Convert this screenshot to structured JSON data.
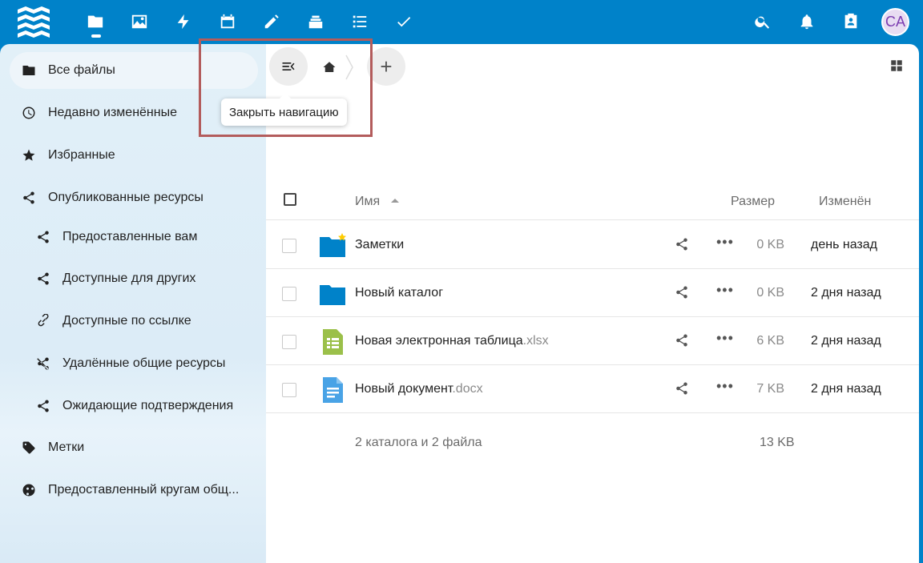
{
  "header": {
    "apps": [
      {
        "name": "files-icon"
      },
      {
        "name": "photos-icon"
      },
      {
        "name": "activity-icon"
      },
      {
        "name": "calendar-icon"
      },
      {
        "name": "notes-icon"
      },
      {
        "name": "deck-icon"
      },
      {
        "name": "tasks-icon"
      },
      {
        "name": "checkmark-icon"
      }
    ],
    "avatar_initials": "CA"
  },
  "sidebar": {
    "items": [
      {
        "label": "Все файлы",
        "icon": "folder-icon",
        "active": true
      },
      {
        "label": "Недавно изменённые",
        "icon": "clock-icon"
      },
      {
        "label": "Избранные",
        "icon": "star-icon"
      },
      {
        "label": "Опубликованные ресурсы",
        "icon": "share-icon"
      },
      {
        "label": "Предоставленные вам",
        "icon": "share-icon",
        "sub": true
      },
      {
        "label": "Доступные для других",
        "icon": "share-icon",
        "sub": true
      },
      {
        "label": "Доступные по ссылке",
        "icon": "link-icon",
        "sub": true
      },
      {
        "label": "Удалённые общие ресурсы",
        "icon": "share-deleted-icon",
        "sub": true
      },
      {
        "label": "Ожидающие подтверждения",
        "icon": "share-icon",
        "sub": true
      },
      {
        "label": "Метки",
        "icon": "tag-icon"
      },
      {
        "label": "Предоставленный кругам общ...",
        "icon": "circles-icon"
      }
    ]
  },
  "toolbar": {
    "tooltip": "Закрыть навигацию",
    "add_label": "+"
  },
  "table": {
    "headers": {
      "name": "Имя",
      "size": "Размер",
      "modified": "Изменён"
    },
    "rows": [
      {
        "name": "Заметки",
        "ext": "",
        "type": "folder",
        "favorite": true,
        "size": "0 KB",
        "modified": "день назад"
      },
      {
        "name": "Новый каталог",
        "ext": "",
        "type": "folder",
        "favorite": false,
        "size": "0 KB",
        "modified": "2 дня назад"
      },
      {
        "name": "Новая электронная таблица",
        "ext": ".xlsx",
        "type": "spreadsheet",
        "favorite": false,
        "size": "6 KB",
        "modified": "2 дня назад"
      },
      {
        "name": "Новый документ",
        "ext": ".docx",
        "type": "document",
        "favorite": false,
        "size": "7 KB",
        "modified": "2 дня назад"
      }
    ],
    "summary": "2 каталога и 2 файла",
    "summary_size": "13 KB"
  },
  "colors": {
    "brand": "#0082c9",
    "folder": "#0082c9",
    "spreadsheet": "#9bc04a",
    "document": "#49a3e6",
    "favorite": "#fc0"
  }
}
